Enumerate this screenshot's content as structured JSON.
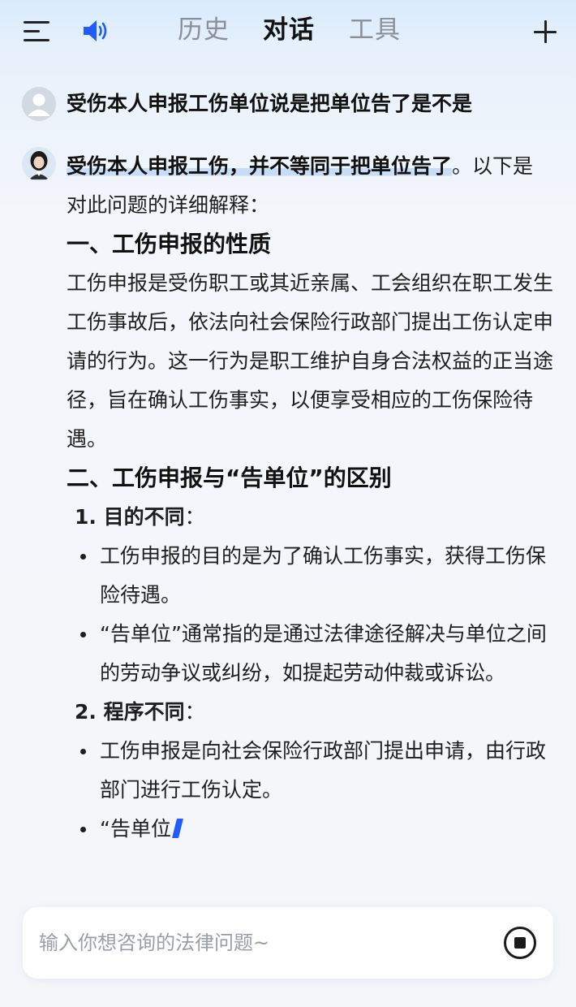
{
  "header": {
    "tabs": [
      {
        "label": "历史",
        "active": false
      },
      {
        "label": "对话",
        "active": true
      },
      {
        "label": "工具",
        "active": false
      }
    ],
    "icons": {
      "menu": "menu-icon",
      "speaker": "speaker-icon",
      "new_chat": "plus-icon"
    },
    "accent_color": "#1f5bff"
  },
  "conversation": {
    "user_message": "受伤本人申报工伤单位说是把单位告了是不是",
    "answer": {
      "lead_highlight": "受伤本人申报工伤，并不等同于把单位告了",
      "lead_rest": "。以下是对此问题的详细解释：",
      "section1_title": "一、工伤申报的性质",
      "section1_body": "工伤申报是受伤职工或其近亲属、工会组织在职工发生工伤事故后，依法向社会保险行政部门提出工伤认定申请的行为。这一行为是职工维护自身合法权益的正当途径，旨在确认工伤事实，以便享受相应的工伤保险待遇。",
      "section2_title": "二、工伤申报与“告单位”的区别",
      "point1_title": "1. 目的不同",
      "point1_bullets": [
        "工伤申报的目的是为了确认工伤事实，获得工伤保险待遇。",
        "“告单位”通常指的是通过法律途径解决与单位之间的劳动争议或纠纷，如提起劳动仲裁或诉讼。"
      ],
      "point2_title": "2. 程序不同",
      "point2_bullets": [
        "工伤申报是向社会保险行政部门提出申请，由行政部门进行工伤认定。",
        "“告单位"
      ]
    }
  },
  "input": {
    "placeholder": "输入你想咨询的法律问题~",
    "value": ""
  }
}
